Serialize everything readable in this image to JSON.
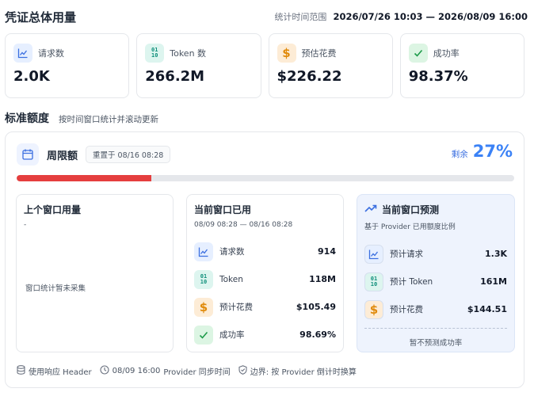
{
  "header": {
    "title": "凭证总体用量",
    "range_label": "统计时间范围",
    "range_value": "2026/07/26 10:03 — 2026/08/09 16:00"
  },
  "stats": [
    {
      "label": "请求数",
      "value": "2.0K",
      "icon": "chart-line-icon"
    },
    {
      "label": "Token 数",
      "value": "266.2M",
      "icon": "binary-icon"
    },
    {
      "label": "预估花费",
      "value": "$226.22",
      "icon": "dollar-icon"
    },
    {
      "label": "成功率",
      "value": "98.37%",
      "icon": "check-icon"
    }
  ],
  "section": {
    "title": "标准额度",
    "subtitle": "按时间窗口统计并滚动更新"
  },
  "quota": {
    "name": "周限额",
    "reset_badge": "重置于 08/16 08:28",
    "remain_label": "剩余",
    "remain_value": "27%",
    "used_fraction": 0.27,
    "bar_color": "#e53e3e"
  },
  "panels": {
    "last": {
      "title": "上个窗口用量",
      "dash": "-",
      "empty_note": "窗口统计暂未采集"
    },
    "current": {
      "title": "当前窗口已用",
      "range": "08/09 08:28 — 08/16 08:28",
      "rows": [
        {
          "label": "请求数",
          "value": "914",
          "icon": "chart-line-icon"
        },
        {
          "label": "Token",
          "value": "118M",
          "icon": "binary-icon"
        },
        {
          "label": "预计花费",
          "value": "$105.49",
          "icon": "dollar-icon"
        },
        {
          "label": "成功率",
          "value": "98.69%",
          "icon": "check-icon"
        }
      ]
    },
    "forecast": {
      "title": "当前窗口预测",
      "subtitle": "基于 Provider 已用额度比例",
      "rows": [
        {
          "label": "预计请求",
          "value": "1.3K",
          "icon": "chart-line-icon"
        },
        {
          "label": "预计 Token",
          "value": "161M",
          "icon": "binary-icon"
        },
        {
          "label": "预计花费",
          "value": "$144.51",
          "icon": "dollar-icon"
        }
      ],
      "no_predict": "暂不预测成功率"
    }
  },
  "footer": {
    "source": "使用响应 Header",
    "time": "08/09 16:00",
    "sync": "Provider 同步时间",
    "boundary": "边界: 按 Provider 倒计时换算"
  }
}
